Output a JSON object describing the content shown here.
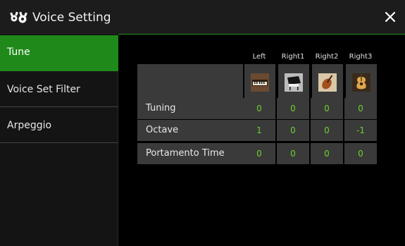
{
  "header": {
    "title": "Voice Setting",
    "icon": "voice-setting-icon",
    "close_icon": "close-icon"
  },
  "sidebar": {
    "items": [
      {
        "label": "Tune",
        "active": true
      },
      {
        "label": "Voice Set Filter",
        "active": false
      },
      {
        "label": "Arpeggio",
        "active": false
      }
    ]
  },
  "table": {
    "columns": [
      "Left",
      "Right1",
      "Right2",
      "Right3"
    ],
    "instrument_icons": [
      "electric-piano-icon",
      "grand-piano-icon",
      "violin-icon",
      "acoustic-guitar-icon"
    ],
    "rows": [
      {
        "label": "Tuning",
        "values": [
          "0",
          "0",
          "0",
          "0"
        ]
      },
      {
        "label": "Octave",
        "values": [
          "1",
          "0",
          "0",
          "-1"
        ]
      },
      {
        "label": "Portamento Time",
        "values": [
          "0",
          "0",
          "0",
          "0"
        ]
      }
    ]
  },
  "colors": {
    "accent": "#1f8a1a",
    "value_text": "#6ed12c",
    "cell_bg": "#3a3a3a"
  }
}
